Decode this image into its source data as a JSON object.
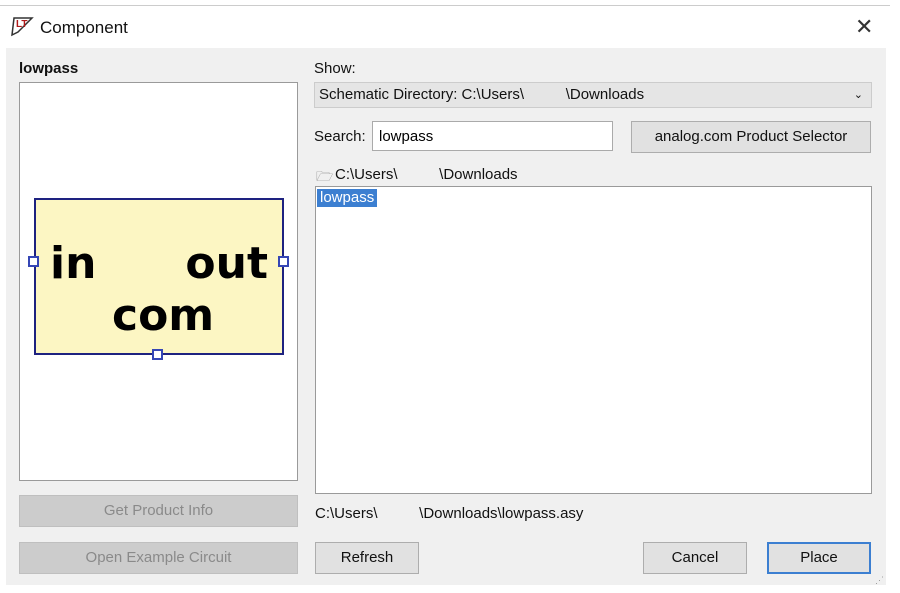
{
  "window": {
    "title": "Component",
    "close_label": "✕"
  },
  "left": {
    "symbol_name": "lowpass",
    "pins": {
      "in": "in",
      "out": "out",
      "com": "com"
    },
    "get_product_info": "Get Product Info",
    "open_example": "Open Example Circuit"
  },
  "right": {
    "show_label": "Show:",
    "show_value": "Schematic Directory: C:\\Users\\          \\Downloads",
    "search_label": "Search:",
    "search_value": "lowpass",
    "selector_button": "analog.com Product Selector",
    "directory": "C:\\Users\\          \\Downloads",
    "list_items": [
      "lowpass"
    ],
    "selected_path": "C:\\Users\\          \\Downloads\\lowpass.asy"
  },
  "buttons": {
    "refresh": "Refresh",
    "cancel": "Cancel",
    "place": "Place"
  },
  "colors": {
    "symbol_fill": "#fcf6c3",
    "symbol_border": "#1e2280",
    "selection": "#3c7fd1"
  }
}
